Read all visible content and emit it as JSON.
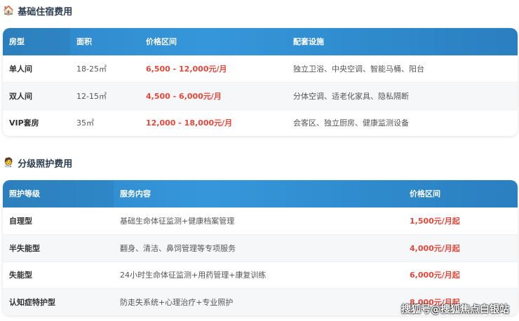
{
  "section1": {
    "title": "基础住宿费用",
    "icon": "house-icon",
    "headers": [
      "房型",
      "面积",
      "价格区间",
      "配套设施"
    ],
    "rows": [
      [
        "单人间",
        "18-25㎡",
        "6,500 - 12,000元/月",
        "独立卫浴、中央空调、智能马桶、阳台"
      ],
      [
        "双人间",
        "12-15㎡",
        "4,500 - 6,000元/月",
        "分体空调、适老化家具、隐私隔断"
      ],
      [
        "VIP套房",
        "35㎡",
        "12,000 - 18,000元/月",
        "会客区、独立厨房、健康监测设备"
      ]
    ]
  },
  "section2": {
    "title": "分级照护费用",
    "icon": "caregiver-icon",
    "headers": [
      "照护等级",
      "服务内容",
      "价格区间"
    ],
    "rows": [
      [
        "自理型",
        "基础生命体征监测+健康档案管理",
        "1,500元/月起"
      ],
      [
        "半失能型",
        "翻身、清洁、鼻饲管理等专项服务",
        "4,000元/月起"
      ],
      [
        "失能型",
        "24小时生命体征监测+用药管理+康复训练",
        "6,000元/月起"
      ],
      [
        "认知症特护型",
        "防走失系统+心理治疗+专业照护",
        "8,000元/月起"
      ]
    ]
  },
  "watermark": "搜狐号@搜狐焦点白银站"
}
